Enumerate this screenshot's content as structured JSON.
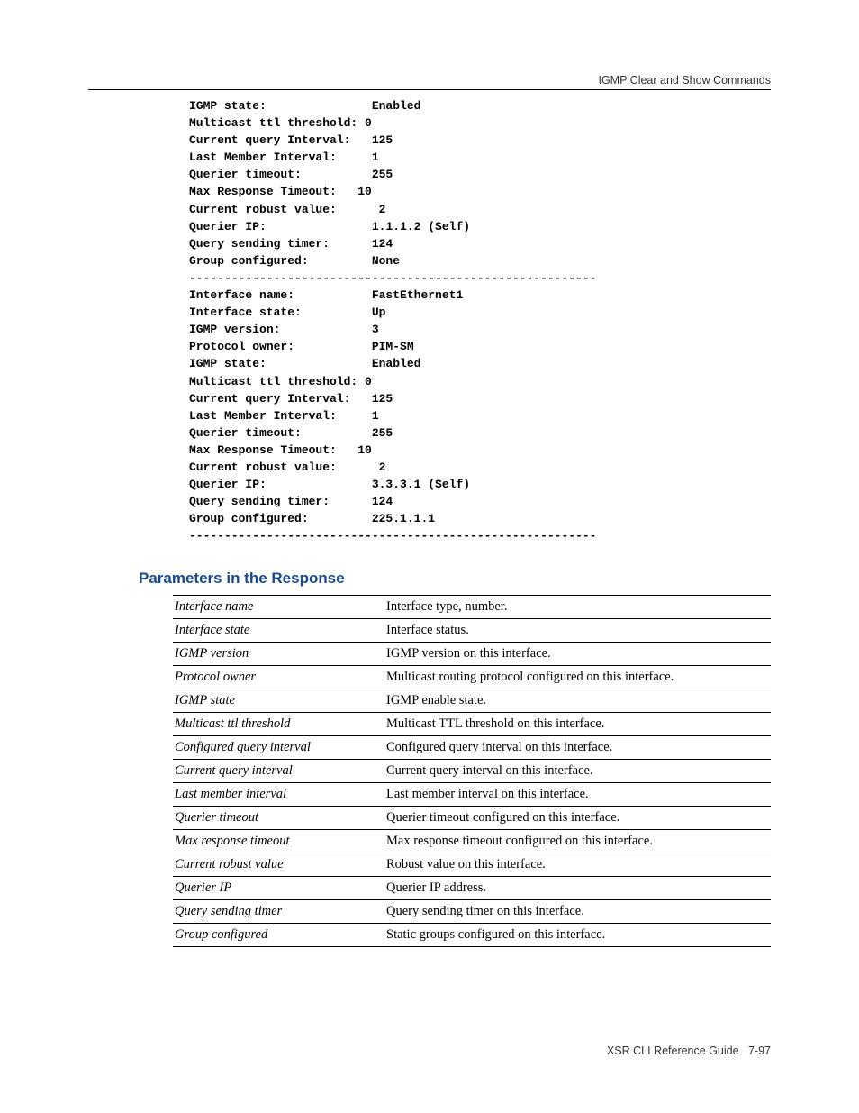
{
  "header": {
    "section": "IGMP Clear and Show Commands"
  },
  "cli": {
    "lines": [
      "IGMP state:               Enabled",
      "Multicast ttl threshold: 0",
      "Current query Interval:   125",
      "Last Member Interval:     1",
      "Querier timeout:          255",
      "Max Response Timeout:   10",
      "Current robust value:      2",
      "Querier IP:               1.1.1.2 (Self)",
      "Query sending timer:      124",
      "Group configured:         None",
      "----------------------------------------------------------",
      "Interface name:           FastEthernet1",
      "Interface state:          Up",
      "IGMP version:             3",
      "Protocol owner:           PIM-SM",
      "IGMP state:               Enabled",
      "Multicast ttl threshold: 0",
      "Current query Interval:   125",
      "Last Member Interval:     1",
      "Querier timeout:          255",
      "Max Response Timeout:   10",
      "Current robust value:      2",
      "Querier IP:               3.3.3.1 (Self)",
      "Query sending timer:      124",
      "Group configured:         225.1.1.1",
      "----------------------------------------------------------"
    ]
  },
  "section_heading": "Parameters in the Response",
  "params": [
    {
      "name": "Interface name",
      "desc": "Interface type, number."
    },
    {
      "name": "Interface state",
      "desc": "Interface status."
    },
    {
      "name": "IGMP version",
      "desc": "IGMP version on this interface."
    },
    {
      "name": "Protocol owner",
      "desc": "Multicast routing protocol configured on this interface."
    },
    {
      "name": "IGMP state",
      "desc": "IGMP enable state."
    },
    {
      "name": "Multicast ttl threshold",
      "desc": "Multicast TTL threshold on this interface."
    },
    {
      "name": "Configured query interval",
      "desc": "Configured query interval on this interface."
    },
    {
      "name": "Current query interval",
      "desc": "Current query interval on this interface."
    },
    {
      "name": "Last member interval",
      "desc": "Last member interval on this interface."
    },
    {
      "name": "Querier timeout",
      "desc": "Querier timeout configured on this interface."
    },
    {
      "name": "Max response timeout",
      "desc": "Max response timeout configured on this interface."
    },
    {
      "name": "Current robust value",
      "desc": "Robust value on this interface."
    },
    {
      "name": "Querier IP",
      "desc": "Querier IP address."
    },
    {
      "name": "Query sending timer",
      "desc": "Query sending timer on this interface."
    },
    {
      "name": "Group configured",
      "desc": "Static groups configured on this interface."
    }
  ],
  "footer": {
    "guide": "XSR CLI Reference Guide",
    "page": "7-97"
  }
}
